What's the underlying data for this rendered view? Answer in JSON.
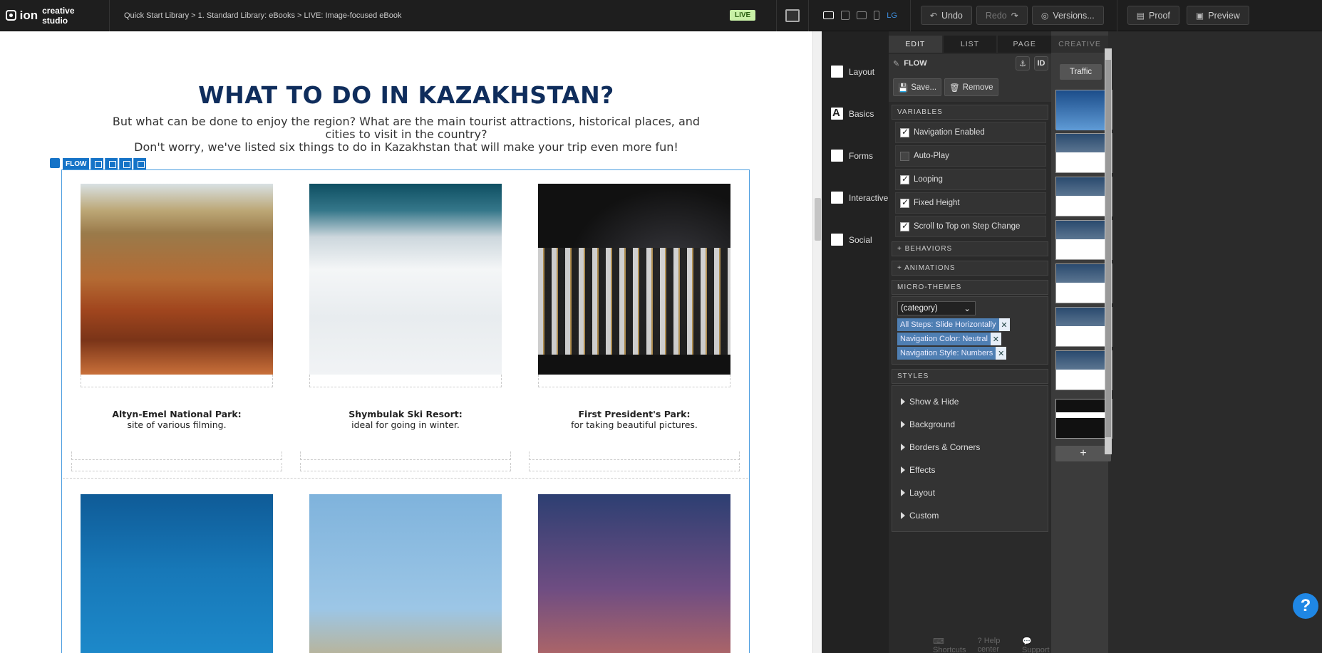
{
  "app": {
    "logo_word": "ion",
    "logo_sub": "creative studio"
  },
  "topbar": {
    "breadcrumb": "Quick Start Library > 1. Standard Library: eBooks > LIVE: Image-focused eBook",
    "live_badge": "LIVE",
    "device_lg": "LG",
    "undo": "Undo",
    "redo": "Redo",
    "versions": "Versions...",
    "proof": "Proof",
    "preview": "Preview"
  },
  "canvas": {
    "title": "WHAT TO DO IN KAZAKHSTAN?",
    "intro_line1": "But what can be done to enjoy the region? What are the main tourist attractions, historical places, and cities to visit in the country?",
    "intro_line2": "Don't worry, we've listed six things to do in Kazakhstan that will make your trip even more fun!",
    "flow_tag": "FLOW",
    "cards": [
      {
        "title": "Altyn-Emel National Park:",
        "subtitle": "site of various filming."
      },
      {
        "title": "Shymbulak Ski Resort:",
        "subtitle": "ideal for going in winter."
      },
      {
        "title": "First President's Park:",
        "subtitle": "for taking beautiful pictures."
      }
    ]
  },
  "leftpanel": {
    "items": [
      "Layout",
      "Basics",
      "Forms",
      "Interactive",
      "Social"
    ]
  },
  "props": {
    "tabs": [
      "EDIT",
      "LIST",
      "PAGE"
    ],
    "flow_label": "FLOW",
    "id_label": "ID",
    "save": "Save...",
    "remove": "Remove",
    "variables_head": "VARIABLES",
    "variables": [
      {
        "label": "Navigation Enabled",
        "checked": true
      },
      {
        "label": "Auto-Play",
        "checked": false
      },
      {
        "label": "Looping",
        "checked": true
      },
      {
        "label": "Fixed Height",
        "checked": true
      },
      {
        "label": "Scroll to Top on Step Change",
        "checked": true
      }
    ],
    "behaviors": "+ BEHAVIORS",
    "animations": "+ ANIMATIONS",
    "microthemes_head": "MICRO-THEMES",
    "category": "(category)",
    "chips": [
      "All Steps: Slide Horizontally",
      "Navigation Color: Neutral",
      "Navigation Style: Numbers"
    ],
    "styles_head": "STYLES",
    "styles": [
      "Show & Hide",
      "Background",
      "Borders & Corners",
      "Effects",
      "Layout",
      "Custom"
    ],
    "shortcuts": "Shortcuts",
    "help_center": "Help center",
    "support": "Support"
  },
  "creative": {
    "tab": "CREATIVE",
    "traffic": "Traffic",
    "add": "+"
  },
  "help_fab": "?"
}
